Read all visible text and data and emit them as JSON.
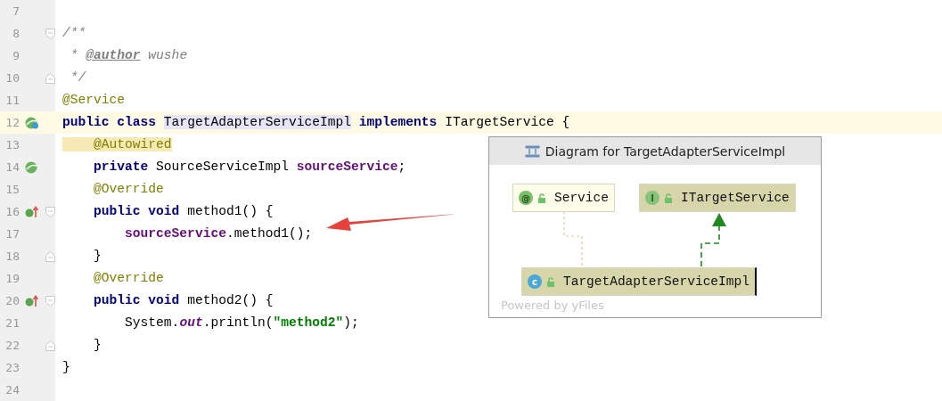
{
  "editor": {
    "lines": [
      {
        "number": "7",
        "current": false
      },
      {
        "number": "8",
        "current": false,
        "fold": {
          "kind": "start"
        },
        "tokens": [
          {
            "text": "/**",
            "kind": "comment"
          }
        ]
      },
      {
        "number": "9",
        "current": false,
        "tokens": [
          {
            "text": " * ",
            "kind": "comment"
          },
          {
            "text": "@author",
            "kind": "doctag"
          },
          {
            "text": " wushe",
            "kind": "comment"
          }
        ]
      },
      {
        "number": "10",
        "current": false,
        "fold": {
          "kind": "end"
        },
        "tokens": [
          {
            "text": " */",
            "kind": "comment"
          }
        ]
      },
      {
        "number": "11",
        "current": false,
        "tokens": [
          {
            "text": "@Service",
            "kind": "annotation"
          }
        ]
      },
      {
        "number": "12",
        "current": true,
        "gutter_icon": {
          "kind": "bean-class"
        },
        "tokens": [
          {
            "text": "public class ",
            "kind": "keyword"
          },
          {
            "text": "TargetAdapterServiceImpl",
            "kind": "class-marked"
          },
          {
            "text": " implements ",
            "kind": "keyword"
          },
          {
            "text": "ITargetService {",
            "kind": "plain"
          }
        ]
      },
      {
        "number": "13",
        "current": false,
        "tokens": [
          {
            "text": "    @Autowired",
            "kind": "annotation-marked"
          }
        ]
      },
      {
        "number": "14",
        "current": false,
        "gutter_icon": {
          "kind": "bean"
        },
        "tokens": [
          {
            "text": "    private ",
            "kind": "keyword"
          },
          {
            "text": "SourceServiceImpl ",
            "kind": "plain"
          },
          {
            "text": "sourceService",
            "kind": "field"
          },
          {
            "text": ";",
            "kind": "plain"
          }
        ]
      },
      {
        "number": "15",
        "current": false,
        "tokens": [
          {
            "text": "    @Override",
            "kind": "annotation"
          }
        ]
      },
      {
        "number": "16",
        "current": false,
        "gutter_icon": {
          "kind": "implements"
        },
        "fold": {
          "kind": "start"
        },
        "tokens": [
          {
            "text": "    public void ",
            "kind": "keyword"
          },
          {
            "text": "method1() {",
            "kind": "plain"
          }
        ]
      },
      {
        "number": "17",
        "current": false,
        "tokens": [
          {
            "text": "        sourceService",
            "kind": "field"
          },
          {
            "text": ".method1();",
            "kind": "plain"
          }
        ]
      },
      {
        "number": "18",
        "current": false,
        "fold": {
          "kind": "end"
        },
        "tokens": [
          {
            "text": "    }",
            "kind": "plain"
          }
        ]
      },
      {
        "number": "19",
        "current": false,
        "tokens": [
          {
            "text": "    @Override",
            "kind": "annotation"
          }
        ]
      },
      {
        "number": "20",
        "current": false,
        "gutter_icon": {
          "kind": "implements"
        },
        "fold": {
          "kind": "start"
        },
        "tokens": [
          {
            "text": "    public void ",
            "kind": "keyword"
          },
          {
            "text": "method2() {",
            "kind": "plain"
          }
        ]
      },
      {
        "number": "21",
        "current": false,
        "tokens": [
          {
            "text": "        System.",
            "kind": "plain"
          },
          {
            "text": "out",
            "kind": "static"
          },
          {
            "text": ".println(",
            "kind": "plain"
          },
          {
            "text": "\"method2\"",
            "kind": "string"
          },
          {
            "text": ");",
            "kind": "plain"
          }
        ]
      },
      {
        "number": "22",
        "current": false,
        "fold": {
          "kind": "end"
        },
        "tokens": [
          {
            "text": "    }",
            "kind": "plain"
          }
        ]
      },
      {
        "number": "23",
        "current": false,
        "tokens": [
          {
            "text": "}",
            "kind": "plain"
          }
        ]
      },
      {
        "number": "24",
        "current": false
      }
    ]
  },
  "diagram_popup": {
    "title": "Diagram for TargetAdapterServiceImpl",
    "nodes": [
      {
        "kind": "annotation",
        "label": "Service",
        "selected": false
      },
      {
        "kind": "interface",
        "label": "ITargetService",
        "selected": false
      },
      {
        "kind": "class",
        "label": "TargetAdapterServiceImpl",
        "selected": true
      }
    ],
    "badge_letters": [
      "@",
      "I",
      "c"
    ],
    "footer": "Powered by yFiles"
  }
}
